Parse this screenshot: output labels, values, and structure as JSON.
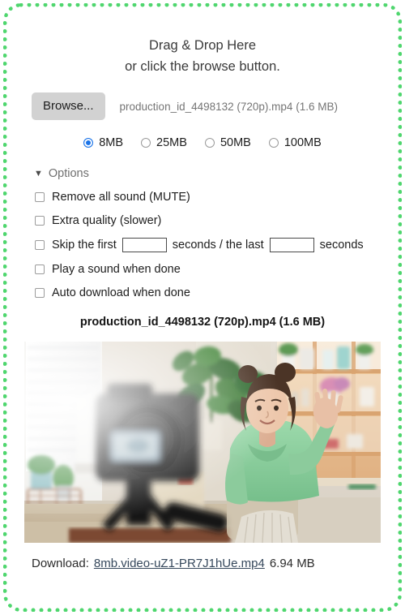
{
  "dropzone": {
    "headline_line1": "Drag & Drop Here",
    "headline_line2": "or click the browse button.",
    "border_color": "#4fd66e"
  },
  "browse": {
    "button_label": "Browse...",
    "selected_file": "production_id_4498132 (720p).mp4 (1.6 MB)"
  },
  "size_options": {
    "selected": "8MB",
    "items": [
      {
        "label": "8MB",
        "selected": true
      },
      {
        "label": "25MB",
        "selected": false
      },
      {
        "label": "50MB",
        "selected": false
      },
      {
        "label": "100MB",
        "selected": false
      }
    ],
    "accent_color": "#1a73e8"
  },
  "options": {
    "caret": "▼",
    "toggle_label": "Options",
    "rows": [
      {
        "label": "Remove all sound (MUTE)",
        "checked": false
      },
      {
        "label": "Extra quality (slower)",
        "checked": false
      },
      {
        "label": "Play a sound when done",
        "checked": false
      },
      {
        "label": "Auto download when done",
        "checked": false
      }
    ],
    "skip_row": {
      "checked": false,
      "label_before": "Skip the first",
      "first_value": "",
      "label_middle": "seconds / the last",
      "last_value": "",
      "label_after": "seconds"
    }
  },
  "result": {
    "title": "production_id_4498132 (720p).mp4 (1.6 MB)",
    "preview_alt": "video-thumbnail-woman-waving-at-camera",
    "download_label": "Download:",
    "download_link": "8mb.video-uZ1-PR7J1hUe.mp4",
    "download_size": "6.94 MB"
  }
}
